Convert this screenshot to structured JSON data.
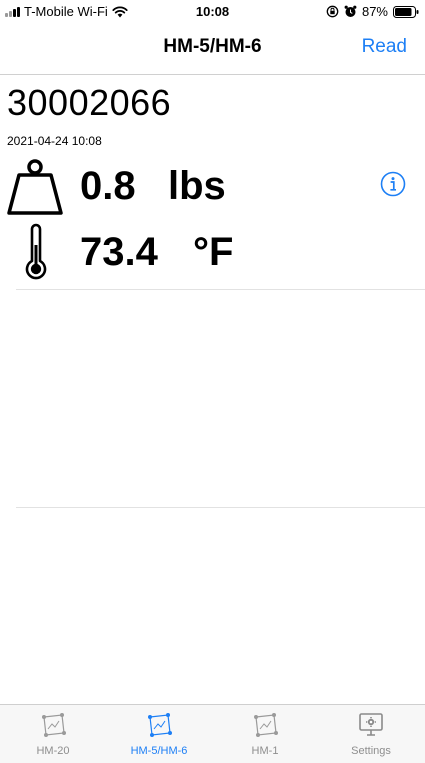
{
  "status_bar": {
    "carrier": "T-Mobile Wi-Fi",
    "time": "10:08",
    "battery": "87%",
    "battery_level": 0.87
  },
  "nav": {
    "title": "HM-5/HM-6",
    "action": "Read"
  },
  "reading": {
    "device_id": "30002066",
    "timestamp": "2021-04-24 10:08",
    "weight_value": "0.8",
    "weight_unit": "lbs",
    "temperature_value": "73.4",
    "temperature_unit": "°F"
  },
  "tabs": [
    {
      "label": "HM-20",
      "icon": "device-map-icon",
      "active": false
    },
    {
      "label": "HM-5/HM-6",
      "icon": "device-map-icon",
      "active": true
    },
    {
      "label": "HM-1",
      "icon": "device-map-icon",
      "active": false
    },
    {
      "label": "Settings",
      "icon": "settings-monitor-icon",
      "active": false
    }
  ],
  "colors": {
    "accent": "#1d7ff5",
    "tab_inactive": "#8e8e8e",
    "divider": "#e2e2e2"
  }
}
